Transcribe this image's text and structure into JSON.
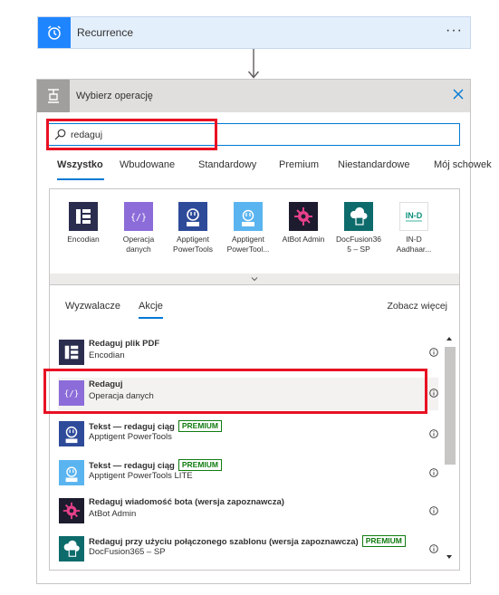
{
  "recurrence": {
    "title": "Recurrence",
    "more": "···"
  },
  "panel": {
    "title": "Wybierz operację",
    "search": {
      "value": "redaguj"
    },
    "tabs": [
      {
        "label": "Wszystko",
        "active": true
      },
      {
        "label": "Wbudowane"
      },
      {
        "label": "Standardowy"
      },
      {
        "label": "Premium"
      },
      {
        "label": "Niestandardowe"
      },
      {
        "label": "Mój schowek"
      }
    ],
    "connectors": [
      {
        "label": "Encodian",
        "icon": "encodian-icon",
        "color": "#2b2d4f"
      },
      {
        "label": "Operacja\ndanych",
        "icon": "data-operation-icon",
        "color": "#8c6cd8"
      },
      {
        "label": "Apptigent\nPowerTools",
        "icon": "apptigent-pro-icon",
        "color": "#2e4b9a"
      },
      {
        "label": "Apptigent\nPowerTool...",
        "icon": "apptigent-lite-icon",
        "color": "#5ab4f0"
      },
      {
        "label": "AtBot Admin",
        "icon": "atbot-icon",
        "color": "#1c1c2e"
      },
      {
        "label": "DocFusion36\n5 – SP",
        "icon": "docfusion-icon",
        "color": "#0e6b6b"
      },
      {
        "label": "IN-D\nAadhaar...",
        "icon": "ind-icon",
        "color": "#ffffff"
      }
    ],
    "subtabs": {
      "triggers": "Wyzwalacze",
      "actions": "Akcje",
      "see_more": "Zobacz więcej"
    },
    "actions": [
      {
        "title": "Redaguj plik PDF",
        "sub": "Encodian",
        "premium": "",
        "icon": "encodian-icon",
        "color": "#2b2d4f"
      },
      {
        "title": "Redaguj",
        "sub": "Operacja danych",
        "premium": "",
        "icon": "data-operation-icon",
        "color": "#8c6cd8"
      },
      {
        "title": "Tekst — redaguj ciąg",
        "sub": "Apptigent PowerTools",
        "premium": "PREMIUM",
        "icon": "apptigent-pro-icon",
        "color": "#2e4b9a"
      },
      {
        "title": "Tekst — redaguj ciąg",
        "sub": "Apptigent PowerTools LITE",
        "premium": "PREMIUM",
        "icon": "apptigent-lite-icon",
        "color": "#5ab4f0"
      },
      {
        "title": "Redaguj wiadomość bota (wersja zapoznawcza)",
        "sub": "AtBot Admin",
        "premium": "",
        "icon": "atbot-icon",
        "color": "#1c1c2e"
      },
      {
        "title": "Redaguj przy użyciu połączonego szablonu (wersja zapoznawcza)",
        "sub": "DocFusion365 – SP",
        "premium": "PREMIUM",
        "icon": "docfusion-icon",
        "color": "#0e6b6b"
      }
    ]
  }
}
